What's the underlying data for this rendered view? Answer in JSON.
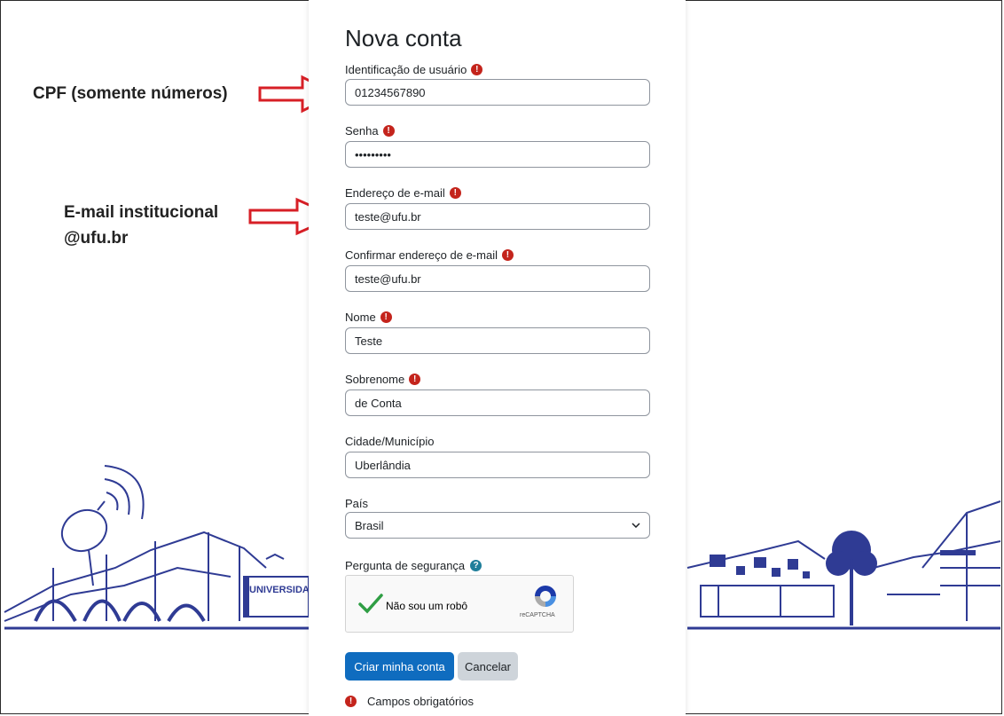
{
  "form": {
    "title": "Nova conta",
    "fields": [
      {
        "label": "Identificação de usuário",
        "value": "01234567890",
        "required": true
      },
      {
        "label": "Senha",
        "value": "•••••••••",
        "required": true
      },
      {
        "label": "Endereço de e-mail",
        "value": "teste@ufu.br",
        "required": true
      },
      {
        "label": "Confirmar endereço de e-mail",
        "value": "teste@ufu.br",
        "required": true
      },
      {
        "label": "Nome",
        "value": "Teste",
        "required": true
      },
      {
        "label": "Sobrenome",
        "value": "de Conta",
        "required": true
      },
      {
        "label": "Cidade/Município",
        "value": "Uberlândia",
        "required": false
      }
    ],
    "country": {
      "label": "País",
      "selected": "Brasil"
    },
    "security_question": {
      "label": "Pergunta de segurança"
    },
    "captcha": {
      "text": "Não sou um robô",
      "brand": "reCAPTCHA",
      "checked": true
    },
    "submit_label": "Criar minha conta",
    "cancel_label": "Cancelar",
    "required_note": "Campos obrigatórios"
  },
  "annotations": {
    "cpf": "CPF (somente números)",
    "email_line1": "E-mail institucional",
    "email_line2": "@ufu.br",
    "arrow_color": "#d71f26"
  },
  "background": {
    "sign_text": "UNIVERSIDA",
    "line_color": "#2f3b94"
  },
  "icons": {
    "required": "exclamation-circle-icon",
    "help": "question-circle-icon",
    "dropdown": "chevron-down-icon",
    "captcha_check": "check-icon",
    "captcha_logo": "recaptcha-logo-icon"
  }
}
